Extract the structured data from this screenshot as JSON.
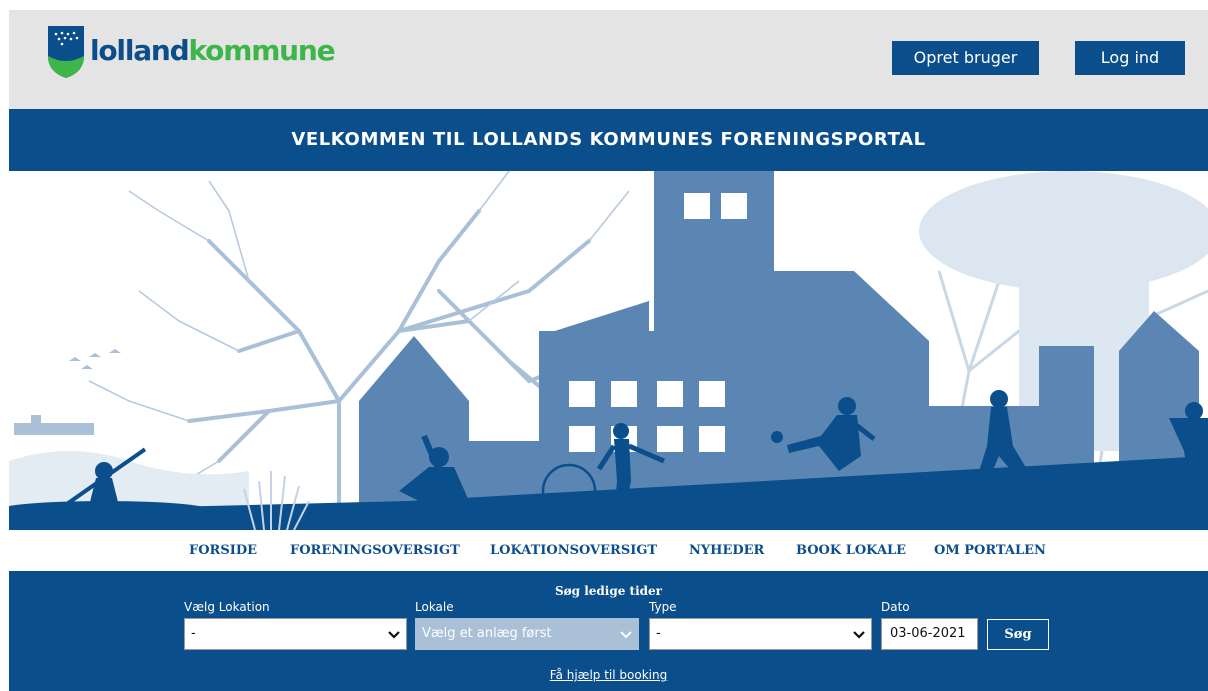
{
  "brand": {
    "logo_text_a": "lolland",
    "logo_text_b": "kommune",
    "colors": {
      "primary": "#0b4e8c",
      "accent_green": "#3db549",
      "header_bg": "#e4e4e4"
    }
  },
  "header": {
    "create_user_label": "Opret bruger",
    "login_label": "Log ind"
  },
  "title": "VELKOMMEN TIL LOLLANDS KOMMUNES FORENINGSPORTAL",
  "hero": {
    "illustration": "town-silhouette-with-sport-figures",
    "colors": {
      "dark": "#0b4e8c",
      "mid": "#5b86b3",
      "light": "#a9c0d8",
      "pale": "#c9d8e6"
    }
  },
  "nav": {
    "items": [
      {
        "label": "FORSIDE"
      },
      {
        "label": "FORENINGSOVERSIGT"
      },
      {
        "label": "LOKATIONSOVERSIGT"
      },
      {
        "label": "NYHEDER"
      },
      {
        "label": "BOOK LOKALE"
      },
      {
        "label": "OM PORTALEN"
      }
    ]
  },
  "search": {
    "title": "Søg ledige tider",
    "location": {
      "label": "Vælg Lokation",
      "value": "-"
    },
    "room": {
      "label": "Lokale",
      "value": "Vælg et anlæg først"
    },
    "type": {
      "label": "Type",
      "value": "-"
    },
    "date": {
      "label": "Dato",
      "value": "03-06-2021"
    },
    "submit_label": "Søg",
    "help_link": "Få hjælp til booking"
  }
}
